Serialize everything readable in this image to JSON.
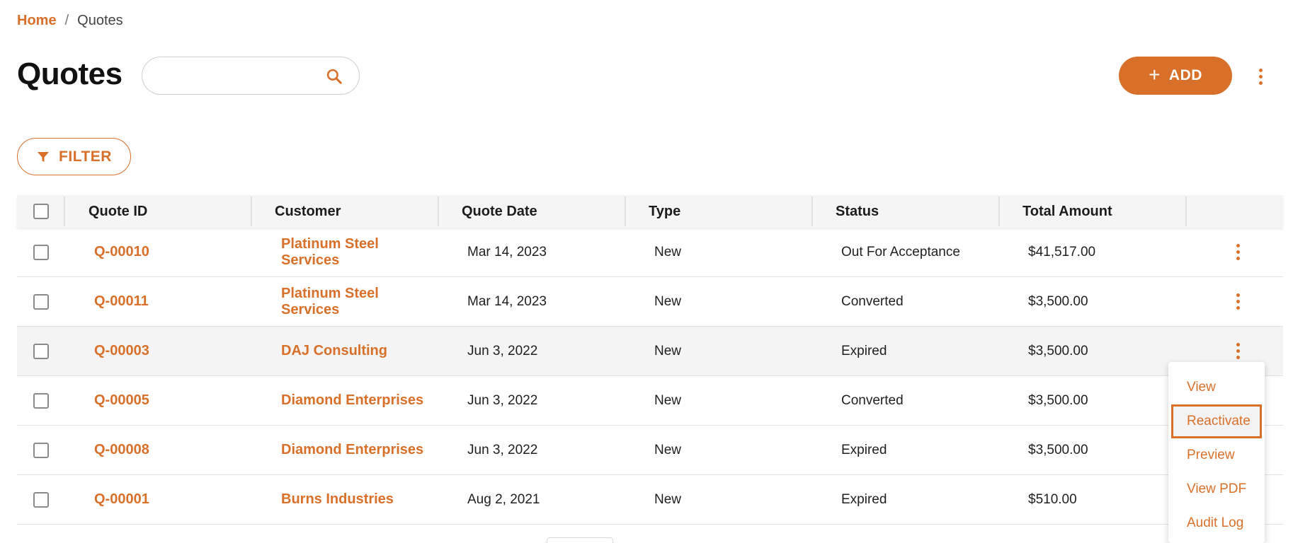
{
  "breadcrumb": {
    "home": "Home",
    "separator": "/",
    "current": "Quotes"
  },
  "page": {
    "title": "Quotes"
  },
  "search": {
    "value": "",
    "placeholder": ""
  },
  "actions": {
    "add_label": "ADD",
    "add_icon": "+",
    "filter_label": "FILTER"
  },
  "colors": {
    "accent": "#d9702a"
  },
  "table": {
    "headers": {
      "quote_id": "Quote ID",
      "customer": "Customer",
      "quote_date": "Quote Date",
      "type": "Type",
      "status": "Status",
      "total_amount": "Total Amount"
    },
    "rows": [
      {
        "id": "Q-00010",
        "customer": "Platinum Steel Services",
        "date": "Mar 14, 2023",
        "type": "New",
        "status": "Out For Acceptance",
        "total": "$41,517.00"
      },
      {
        "id": "Q-00011",
        "customer": "Platinum Steel Services",
        "date": "Mar 14, 2023",
        "type": "New",
        "status": "Converted",
        "total": "$3,500.00"
      },
      {
        "id": "Q-00003",
        "customer": "DAJ Consulting",
        "date": "Jun 3, 2022",
        "type": "New",
        "status": "Expired",
        "total": "$3,500.00"
      },
      {
        "id": "Q-00005",
        "customer": "Diamond Enterprises",
        "date": "Jun 3, 2022",
        "type": "New",
        "status": "Converted",
        "total": "$3,500.00"
      },
      {
        "id": "Q-00008",
        "customer": "Diamond Enterprises",
        "date": "Jun 3, 2022",
        "type": "New",
        "status": "Expired",
        "total": "$3,500.00"
      },
      {
        "id": "Q-00001",
        "customer": "Burns Industries",
        "date": "Aug 2, 2021",
        "type": "New",
        "status": "Expired",
        "total": "$510.00"
      }
    ]
  },
  "row_menu": {
    "items": [
      "View",
      "Reactivate",
      "Preview",
      "View PDF",
      "Audit Log"
    ],
    "active_item": "Reactivate"
  }
}
